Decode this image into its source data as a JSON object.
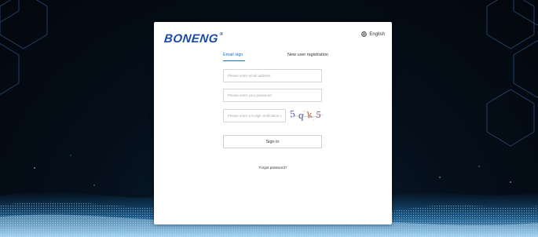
{
  "brand": {
    "logo_text": "BONENG",
    "registered_mark": "®"
  },
  "language": {
    "label": "English",
    "icon": "globe-icon"
  },
  "tabs": {
    "email_sign": "Email sign",
    "new_user_registration": "New user registration"
  },
  "form": {
    "email_placeholder": "Please enter email address",
    "password_placeholder": "Please enter your password",
    "code_placeholder": "Please enter a 6-digit verification code",
    "captcha_text": "5qk5",
    "sign_in_label": "Sign in",
    "forgot_password_label": "Forgot password?"
  },
  "colors": {
    "accent": "#1a6fd1",
    "logo": "#1a4aa8",
    "background_dark": "#03070d",
    "glow": "#2a8fd6"
  }
}
